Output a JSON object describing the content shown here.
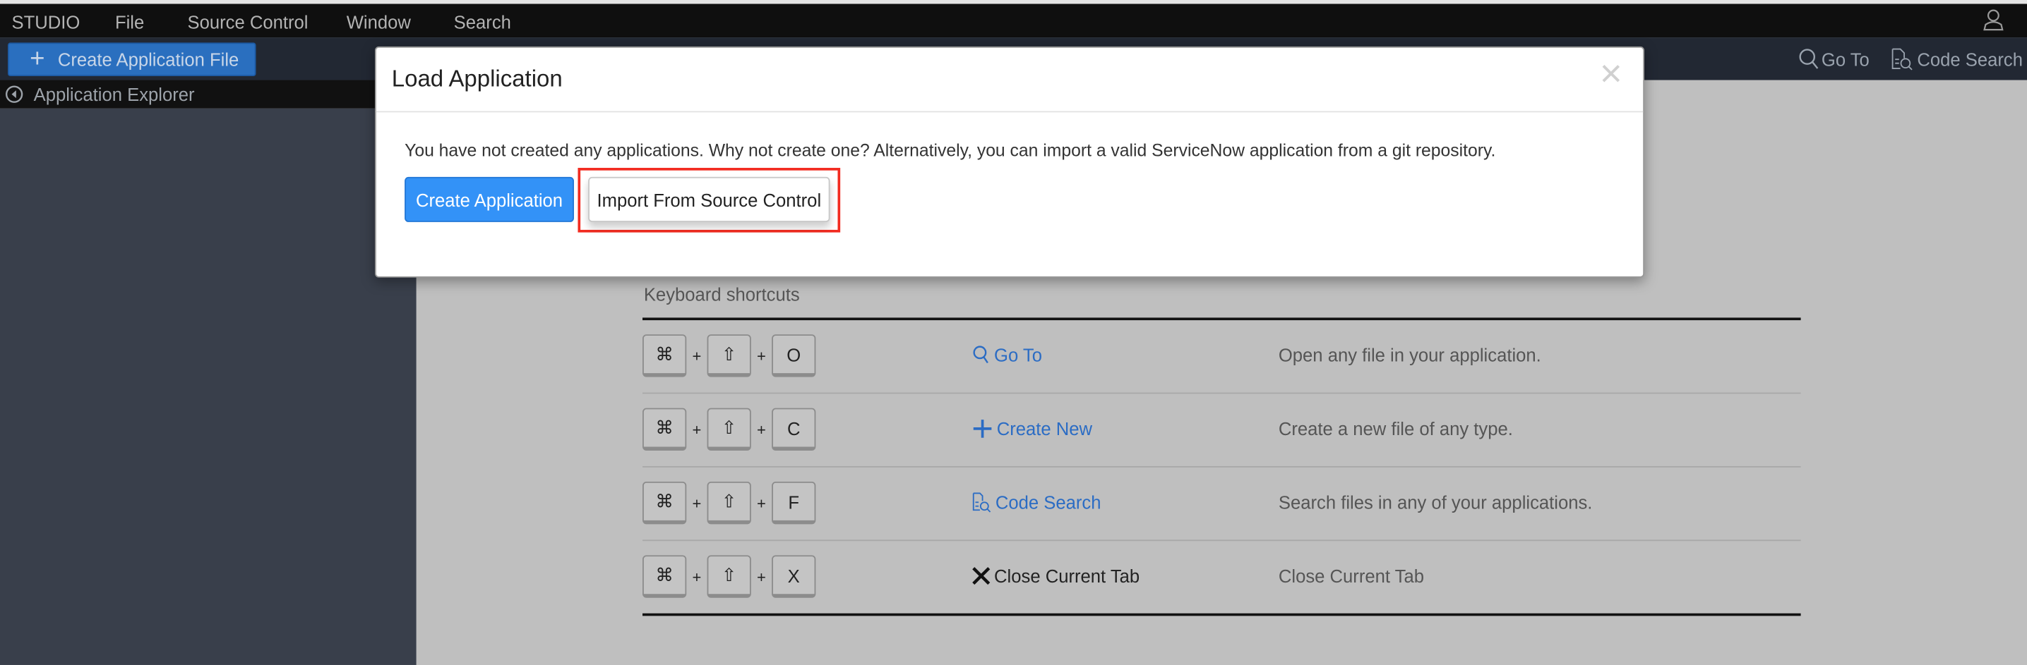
{
  "menubar": {
    "items": [
      "STUDIO",
      "File",
      "Source Control",
      "Window",
      "Search"
    ]
  },
  "toolbar": {
    "create_file_label": "Create Application File",
    "goto_label": "Go To",
    "code_search_label": "Code Search"
  },
  "sidebar": {
    "title": "Application Explorer"
  },
  "dialog": {
    "title": "Load Application",
    "close_glyph": "×",
    "message": "You have not created any applications. Why not create one? Alternatively, you can import a valid ServiceNow application from a git repository.",
    "create_label": "Create Application",
    "import_label": "Import From Source Control"
  },
  "shortcuts": {
    "label": "Keyboard shortcuts",
    "plus": "+",
    "rows": [
      {
        "keys": [
          "⌘",
          "⇧",
          "O"
        ],
        "action": "Go To",
        "icon": "search-icon",
        "description": "Open any file in your application."
      },
      {
        "keys": [
          "⌘",
          "⇧",
          "C"
        ],
        "action": "Create New",
        "icon": "plus-icon",
        "description": "Create a new file of any type."
      },
      {
        "keys": [
          "⌘",
          "⇧",
          "F"
        ],
        "action": "Code Search",
        "icon": "code-search-icon",
        "description": "Search files in any of your applications."
      },
      {
        "keys": [
          "⌘",
          "⇧",
          "X"
        ],
        "action": "Close Current Tab",
        "icon": "close-icon",
        "description": "Close Current Tab"
      }
    ]
  },
  "colors": {
    "accent": "#3392f7",
    "toolbar_button": "#2a6fbf",
    "link": "#2b6cc4",
    "highlight": "#f22b20"
  }
}
